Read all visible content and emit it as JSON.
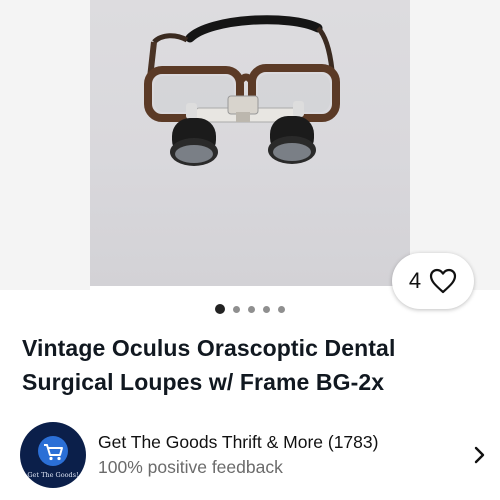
{
  "listing": {
    "title_line1": "Vintage Oculus Orascoptic Dental",
    "title_line2": "Surgical Loupes w/ Frame BG-2x",
    "like_count": "4",
    "image_count": 5,
    "active_image": 1
  },
  "seller": {
    "name": "Get The Goods Thrift & More (1783)",
    "feedback": "100% positive feedback",
    "avatar_text": "Get The Goods!"
  },
  "icons": {
    "like": "heart-icon",
    "seller_link": "chevron-right-icon",
    "avatar": "shopping-cart-icon"
  },
  "colors": {
    "avatar_bg": "#0b1f4a",
    "text_primary": "#111820",
    "text_secondary": "#6b6b6b"
  }
}
